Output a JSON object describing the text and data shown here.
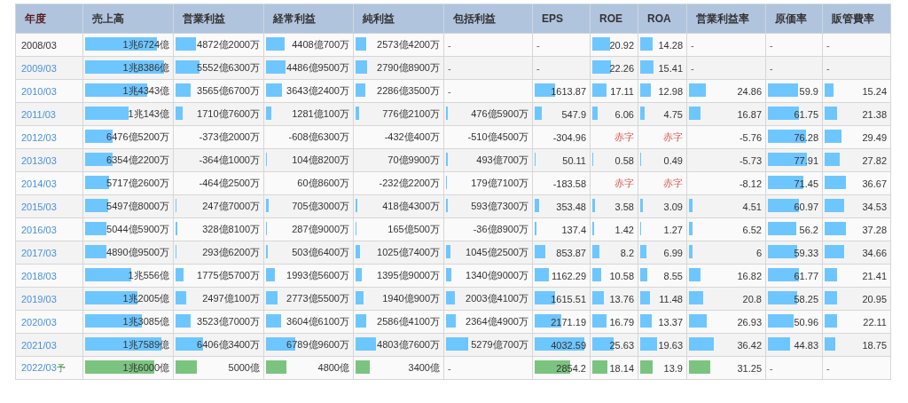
{
  "table": {
    "year_column": "年度",
    "columns": [
      "売上高",
      "営業利益",
      "経常利益",
      "純利益",
      "包括利益",
      "EPS",
      "ROE",
      "ROA",
      "営業利益率",
      "原価率",
      "販管費率"
    ],
    "rows": [
      {
        "year": "2008/03",
        "link": false,
        "forecast": false,
        "cells": [
          {
            "kind": "value",
            "text": "1兆6724億",
            "level": 0.8
          },
          {
            "kind": "value",
            "text": "4872億2000万",
            "level": 0.23
          },
          {
            "kind": "value",
            "text": "4408億700万",
            "level": 0.21
          },
          {
            "kind": "value",
            "text": "2573億4200万",
            "level": 0.12
          },
          {
            "kind": "none",
            "text": "-"
          },
          {
            "kind": "none",
            "text": "-"
          },
          {
            "kind": "value",
            "text": "20.92",
            "level": 0.38
          },
          {
            "kind": "value",
            "text": "14.28",
            "level": 0.26
          },
          {
            "kind": "none",
            "text": "-"
          },
          {
            "kind": "none",
            "text": "-"
          },
          {
            "kind": "none",
            "text": "-"
          }
        ]
      },
      {
        "year": "2009/03",
        "link": true,
        "forecast": false,
        "cells": [
          {
            "kind": "value",
            "text": "1兆8386億",
            "level": 0.88
          },
          {
            "kind": "value",
            "text": "5552億6300万",
            "level": 0.27
          },
          {
            "kind": "value",
            "text": "4486億9500万",
            "level": 0.22
          },
          {
            "kind": "value",
            "text": "2790億8900万",
            "level": 0.13
          },
          {
            "kind": "none",
            "text": "-"
          },
          {
            "kind": "none",
            "text": "-"
          },
          {
            "kind": "value",
            "text": "22.26",
            "level": 0.4
          },
          {
            "kind": "value",
            "text": "15.41",
            "level": 0.28
          },
          {
            "kind": "none",
            "text": "-"
          },
          {
            "kind": "none",
            "text": "-"
          },
          {
            "kind": "none",
            "text": "-"
          }
        ]
      },
      {
        "year": "2010/03",
        "link": true,
        "forecast": false,
        "cells": [
          {
            "kind": "value",
            "text": "1兆4343億",
            "level": 0.69
          },
          {
            "kind": "value",
            "text": "3565億6700万",
            "level": 0.17
          },
          {
            "kind": "value",
            "text": "3643億2400万",
            "level": 0.18
          },
          {
            "kind": "value",
            "text": "2286億3500万",
            "level": 0.11
          },
          {
            "kind": "none",
            "text": "-"
          },
          {
            "kind": "value",
            "text": "1613.87",
            "level": 0.36
          },
          {
            "kind": "value",
            "text": "17.11",
            "level": 0.31
          },
          {
            "kind": "value",
            "text": "12.98",
            "level": 0.23
          },
          {
            "kind": "value",
            "text": "24.86",
            "level": 0.22
          },
          {
            "kind": "value",
            "text": "59.9",
            "level": 0.54
          },
          {
            "kind": "value",
            "text": "15.24",
            "level": 0.13
          }
        ]
      },
      {
        "year": "2011/03",
        "link": true,
        "forecast": false,
        "cells": [
          {
            "kind": "value",
            "text": "1兆143億",
            "level": 0.49
          },
          {
            "kind": "value",
            "text": "1710億7600万",
            "level": 0.08
          },
          {
            "kind": "value",
            "text": "1281億100万",
            "level": 0.06
          },
          {
            "kind": "value",
            "text": "776億2100万",
            "level": 0.04
          },
          {
            "kind": "value",
            "text": "476億5900万",
            "level": 0.02
          },
          {
            "kind": "value",
            "text": "547.9",
            "level": 0.12
          },
          {
            "kind": "value",
            "text": "6.06",
            "level": 0.11
          },
          {
            "kind": "value",
            "text": "4.75",
            "level": 0.09
          },
          {
            "kind": "value",
            "text": "16.87",
            "level": 0.15
          },
          {
            "kind": "value",
            "text": "61.75",
            "level": 0.56
          },
          {
            "kind": "value",
            "text": "21.38",
            "level": 0.18
          }
        ]
      },
      {
        "year": "2012/03",
        "link": true,
        "forecast": false,
        "cells": [
          {
            "kind": "value",
            "text": "6476億5200万",
            "level": 0.31
          },
          {
            "kind": "value",
            "text": "-373億2000万"
          },
          {
            "kind": "value",
            "text": "-608億6300万"
          },
          {
            "kind": "value",
            "text": "-432億400万"
          },
          {
            "kind": "value",
            "text": "-510億4500万"
          },
          {
            "kind": "value",
            "text": "-304.96"
          },
          {
            "kind": "deficit",
            "text": "赤字"
          },
          {
            "kind": "deficit",
            "text": "赤字"
          },
          {
            "kind": "value",
            "text": "-5.76"
          },
          {
            "kind": "value",
            "text": "76.28",
            "level": 0.69
          },
          {
            "kind": "value",
            "text": "29.49",
            "level": 0.25
          }
        ]
      },
      {
        "year": "2013/03",
        "link": true,
        "forecast": false,
        "cells": [
          {
            "kind": "value",
            "text": "6354億2200万",
            "level": 0.31
          },
          {
            "kind": "value",
            "text": "-364億1000万"
          },
          {
            "kind": "value",
            "text": "104億8200万",
            "level": 0.01
          },
          {
            "kind": "value",
            "text": "70億9900万"
          },
          {
            "kind": "value",
            "text": "493億700万",
            "level": 0.02
          },
          {
            "kind": "value",
            "text": "50.11",
            "level": 0.02
          },
          {
            "kind": "value",
            "text": "0.58",
            "level": 0.02
          },
          {
            "kind": "value",
            "text": "0.49",
            "level": 0.02
          },
          {
            "kind": "value",
            "text": "-5.73"
          },
          {
            "kind": "value",
            "text": "77.91",
            "level": 0.7
          },
          {
            "kind": "value",
            "text": "27.82",
            "level": 0.23
          }
        ]
      },
      {
        "year": "2014/03",
        "link": true,
        "forecast": false,
        "cells": [
          {
            "kind": "value",
            "text": "5717億2600万",
            "level": 0.27
          },
          {
            "kind": "value",
            "text": "-464億2500万"
          },
          {
            "kind": "value",
            "text": "60億8600万"
          },
          {
            "kind": "value",
            "text": "-232億2200万"
          },
          {
            "kind": "value",
            "text": "179億7100万",
            "level": 0.01
          },
          {
            "kind": "value",
            "text": "-183.58"
          },
          {
            "kind": "deficit",
            "text": "赤字"
          },
          {
            "kind": "deficit",
            "text": "赤字"
          },
          {
            "kind": "value",
            "text": "-8.12"
          },
          {
            "kind": "value",
            "text": "71.45",
            "level": 0.64
          },
          {
            "kind": "value",
            "text": "36.67",
            "level": 0.31
          }
        ]
      },
      {
        "year": "2015/03",
        "link": true,
        "forecast": false,
        "cells": [
          {
            "kind": "value",
            "text": "5497億8000万",
            "level": 0.26
          },
          {
            "kind": "value",
            "text": "247億7000万",
            "level": 0.012
          },
          {
            "kind": "value",
            "text": "705億3000万",
            "level": 0.034
          },
          {
            "kind": "value",
            "text": "418億4300万",
            "level": 0.02
          },
          {
            "kind": "value",
            "text": "593億7300万",
            "level": 0.02
          },
          {
            "kind": "value",
            "text": "353.48",
            "level": 0.08
          },
          {
            "kind": "value",
            "text": "3.58",
            "level": 0.06
          },
          {
            "kind": "value",
            "text": "3.09",
            "level": 0.06
          },
          {
            "kind": "value",
            "text": "4.51",
            "level": 0.04
          },
          {
            "kind": "value",
            "text": "60.97",
            "level": 0.55
          },
          {
            "kind": "value",
            "text": "34.53",
            "level": 0.29
          }
        ]
      },
      {
        "year": "2016/03",
        "link": true,
        "forecast": false,
        "cells": [
          {
            "kind": "value",
            "text": "5044億5900万",
            "level": 0.24
          },
          {
            "kind": "value",
            "text": "328億8100万",
            "level": 0.016
          },
          {
            "kind": "value",
            "text": "287億9000万",
            "level": 0.014
          },
          {
            "kind": "value",
            "text": "165億500万",
            "level": 0.01
          },
          {
            "kind": "value",
            "text": "-36億8900万"
          },
          {
            "kind": "value",
            "text": "137.4",
            "level": 0.03
          },
          {
            "kind": "value",
            "text": "1.42",
            "level": 0.03
          },
          {
            "kind": "value",
            "text": "1.27",
            "level": 0.02
          },
          {
            "kind": "value",
            "text": "6.52",
            "level": 0.05
          },
          {
            "kind": "value",
            "text": "56.2",
            "level": 0.51
          },
          {
            "kind": "value",
            "text": "37.28",
            "level": 0.31
          }
        ]
      },
      {
        "year": "2017/03",
        "link": true,
        "forecast": false,
        "cells": [
          {
            "kind": "value",
            "text": "4890億9500万",
            "level": 0.24
          },
          {
            "kind": "value",
            "text": "293億6200万",
            "level": 0.014
          },
          {
            "kind": "value",
            "text": "503億6400万",
            "level": 0.024
          },
          {
            "kind": "value",
            "text": "1025億7400万",
            "level": 0.05
          },
          {
            "kind": "value",
            "text": "1045億2500万",
            "level": 0.05
          },
          {
            "kind": "value",
            "text": "853.87",
            "level": 0.19
          },
          {
            "kind": "value",
            "text": "8.2",
            "level": 0.15
          },
          {
            "kind": "value",
            "text": "6.99",
            "level": 0.13
          },
          {
            "kind": "value",
            "text": "6",
            "level": 0.05
          },
          {
            "kind": "value",
            "text": "59.33",
            "level": 0.53
          },
          {
            "kind": "value",
            "text": "34.66",
            "level": 0.29
          }
        ]
      },
      {
        "year": "2018/03",
        "link": true,
        "forecast": false,
        "cells": [
          {
            "kind": "value",
            "text": "1兆556億",
            "level": 0.51
          },
          {
            "kind": "value",
            "text": "1775億5700万",
            "level": 0.085
          },
          {
            "kind": "value",
            "text": "1993億5600万",
            "level": 0.096
          },
          {
            "kind": "value",
            "text": "1395億9000万",
            "level": 0.067
          },
          {
            "kind": "value",
            "text": "1340億9000万",
            "level": 0.064
          },
          {
            "kind": "value",
            "text": "1162.29",
            "level": 0.25
          },
          {
            "kind": "value",
            "text": "10.58",
            "level": 0.19
          },
          {
            "kind": "value",
            "text": "8.55",
            "level": 0.15
          },
          {
            "kind": "value",
            "text": "16.82",
            "level": 0.15
          },
          {
            "kind": "value",
            "text": "61.77",
            "level": 0.56
          },
          {
            "kind": "value",
            "text": "21.41",
            "level": 0.18
          }
        ]
      },
      {
        "year": "2019/03",
        "link": true,
        "forecast": false,
        "cells": [
          {
            "kind": "value",
            "text": "1兆2005億",
            "level": 0.58
          },
          {
            "kind": "value",
            "text": "2497億100万",
            "level": 0.12
          },
          {
            "kind": "value",
            "text": "2773億5500万",
            "level": 0.13
          },
          {
            "kind": "value",
            "text": "1940億900万",
            "level": 0.093
          },
          {
            "kind": "value",
            "text": "2003億4100万",
            "level": 0.096
          },
          {
            "kind": "value",
            "text": "1615.51",
            "level": 0.36
          },
          {
            "kind": "value",
            "text": "13.76",
            "level": 0.25
          },
          {
            "kind": "value",
            "text": "11.48",
            "level": 0.21
          },
          {
            "kind": "value",
            "text": "20.8",
            "level": 0.18
          },
          {
            "kind": "value",
            "text": "58.25",
            "level": 0.52
          },
          {
            "kind": "value",
            "text": "20.95",
            "level": 0.18
          }
        ]
      },
      {
        "year": "2020/03",
        "link": true,
        "forecast": false,
        "cells": [
          {
            "kind": "value",
            "text": "1兆3085億",
            "level": 0.63
          },
          {
            "kind": "value",
            "text": "3523億7000万",
            "level": 0.17
          },
          {
            "kind": "value",
            "text": "3604億6100万",
            "level": 0.17
          },
          {
            "kind": "value",
            "text": "2586億4100万",
            "level": 0.12
          },
          {
            "kind": "value",
            "text": "2364億4900万",
            "level": 0.11
          },
          {
            "kind": "value",
            "text": "2171.19",
            "level": 0.47
          },
          {
            "kind": "value",
            "text": "16.79",
            "level": 0.3
          },
          {
            "kind": "value",
            "text": "13.37",
            "level": 0.24
          },
          {
            "kind": "value",
            "text": "26.93",
            "level": 0.23
          },
          {
            "kind": "value",
            "text": "50.96",
            "level": 0.46
          },
          {
            "kind": "value",
            "text": "22.11",
            "level": 0.19
          }
        ]
      },
      {
        "year": "2021/03",
        "link": true,
        "forecast": false,
        "cells": [
          {
            "kind": "value",
            "text": "1兆7589億",
            "level": 0.85
          },
          {
            "kind": "value",
            "text": "6406億3400万",
            "level": 0.31
          },
          {
            "kind": "value",
            "text": "6789億9600万",
            "level": 0.33
          },
          {
            "kind": "value",
            "text": "4803億7600万",
            "level": 0.23
          },
          {
            "kind": "value",
            "text": "5279億700万",
            "level": 0.25
          },
          {
            "kind": "value",
            "text": "4032.59",
            "level": 0.88
          },
          {
            "kind": "value",
            "text": "25.63",
            "level": 0.46
          },
          {
            "kind": "value",
            "text": "19.63",
            "level": 0.35
          },
          {
            "kind": "value",
            "text": "36.42",
            "level": 0.32
          },
          {
            "kind": "value",
            "text": "44.83",
            "level": 0.4
          },
          {
            "kind": "value",
            "text": "18.75",
            "level": 0.16
          }
        ]
      },
      {
        "year": "2022/03",
        "link": true,
        "forecast": true,
        "note": "予",
        "cells": [
          {
            "kind": "value",
            "text": "1兆6000億",
            "level": 0.77
          },
          {
            "kind": "value",
            "text": "5000億",
            "level": 0.24
          },
          {
            "kind": "value",
            "text": "4800億",
            "level": 0.23
          },
          {
            "kind": "value",
            "text": "3400億",
            "level": 0.16
          },
          {
            "kind": "none",
            "text": "-"
          },
          {
            "kind": "value",
            "text": "2854.2",
            "level": 0.62
          },
          {
            "kind": "value",
            "text": "18.14",
            "level": 0.33
          },
          {
            "kind": "value",
            "text": "13.9",
            "level": 0.25
          },
          {
            "kind": "value",
            "text": "31.25",
            "level": 0.27
          },
          {
            "kind": "none",
            "text": "-"
          },
          {
            "kind": "none",
            "text": "-"
          }
        ]
      }
    ]
  }
}
